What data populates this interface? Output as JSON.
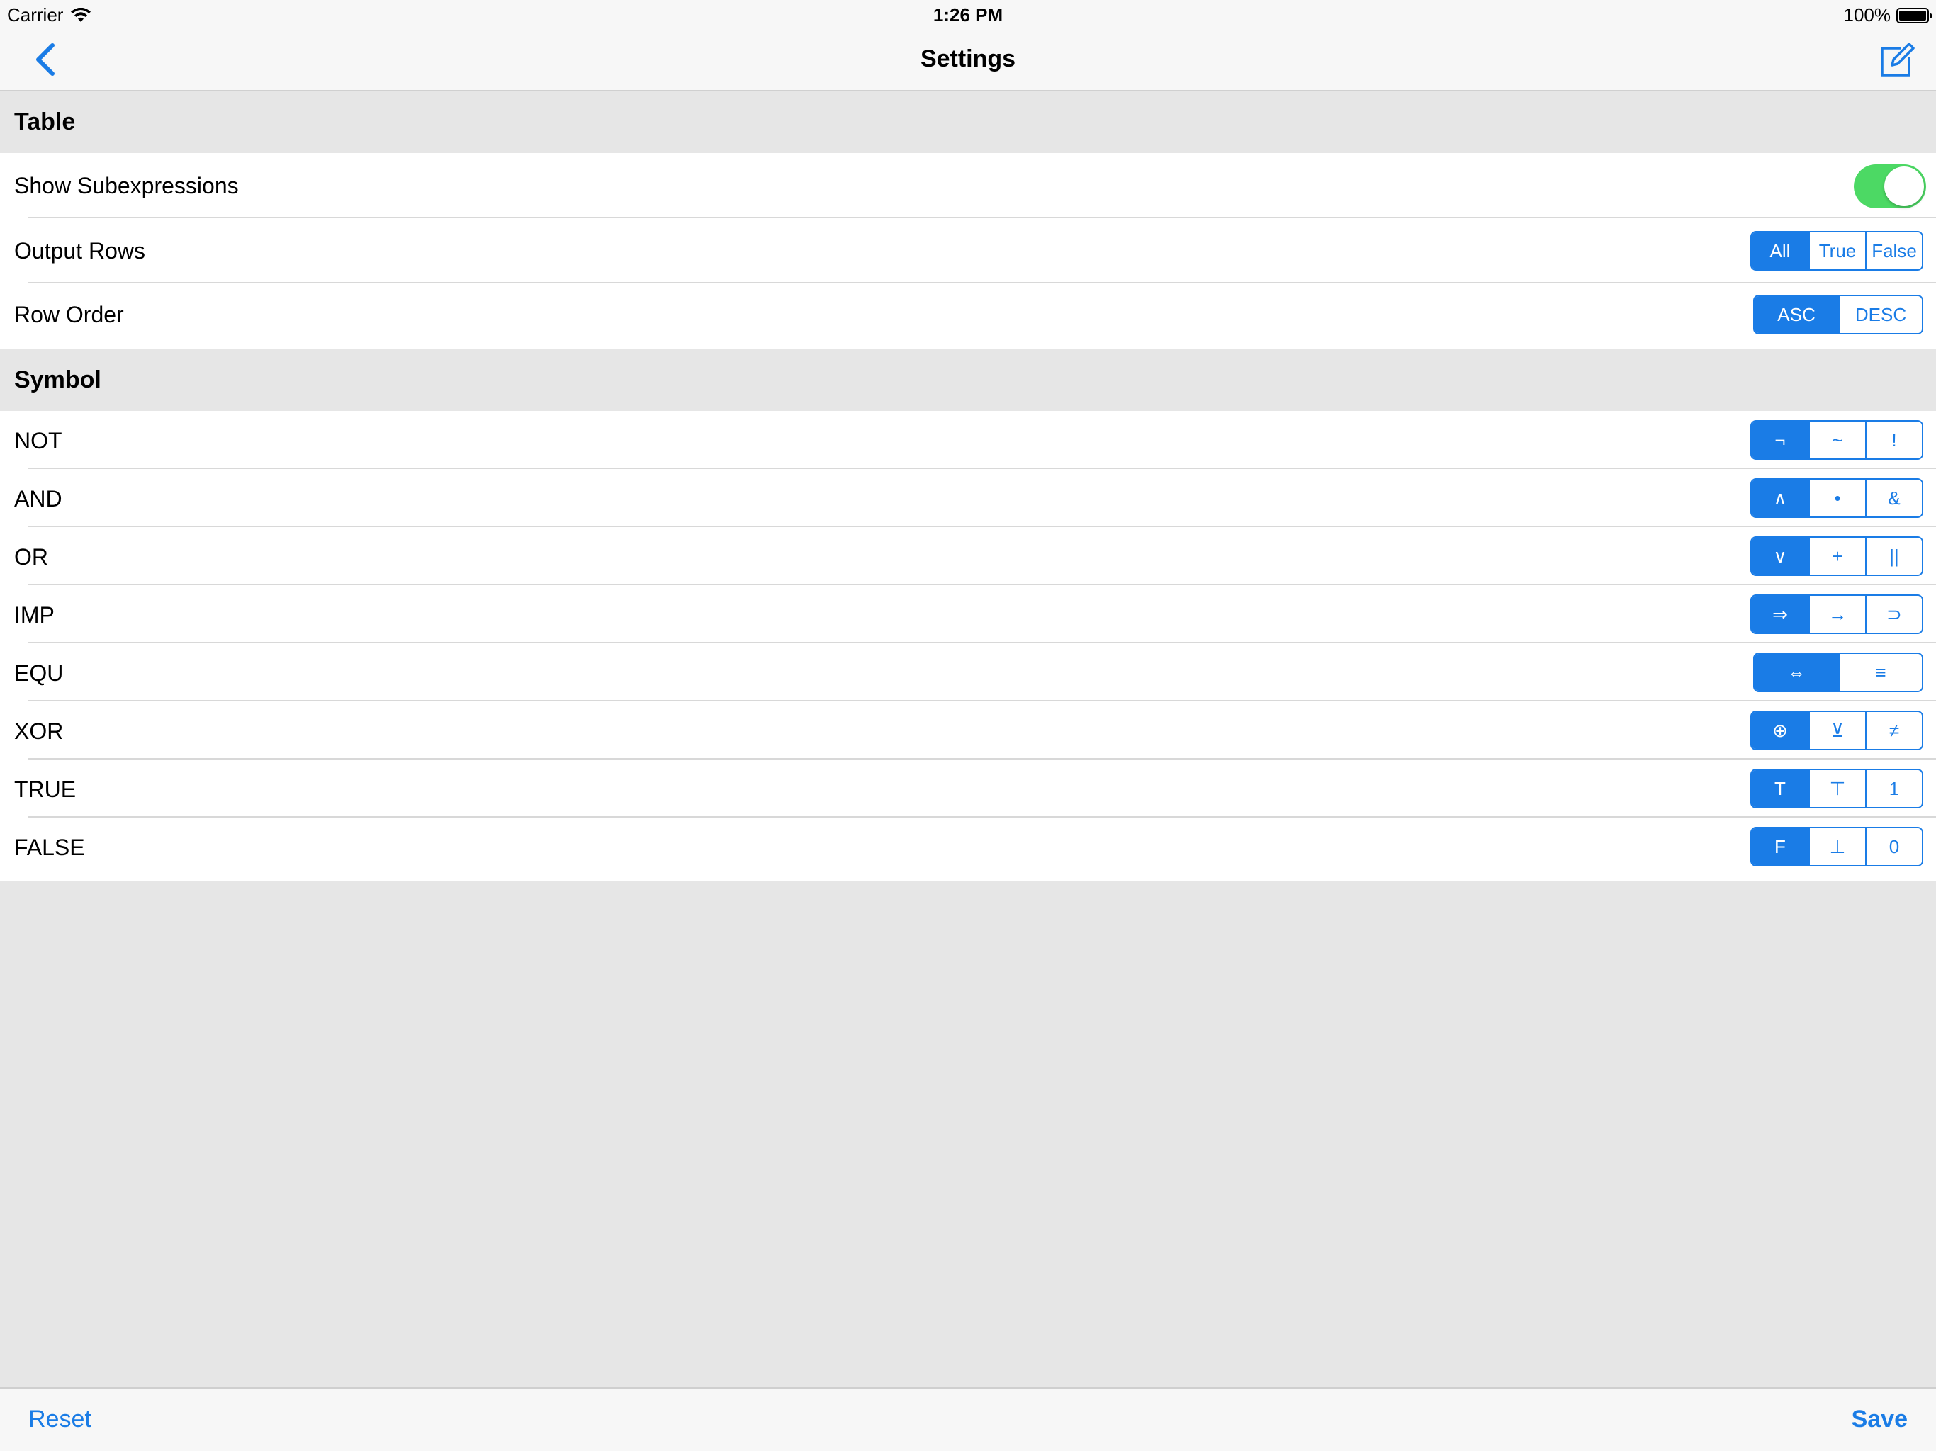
{
  "status_bar": {
    "carrier": "Carrier",
    "time": "1:26 PM",
    "battery": "100%"
  },
  "nav": {
    "title": "Settings",
    "back_icon": "chevron-left-icon",
    "compose_icon": "compose-icon"
  },
  "sections": {
    "table": {
      "header": "Table",
      "show_subexpressions": {
        "label": "Show  Subexpressions",
        "on": true
      },
      "output_rows": {
        "label": "Output Rows",
        "options": [
          "All",
          "True",
          "False"
        ],
        "selected": "All"
      },
      "row_order": {
        "label": "Row Order",
        "options": [
          "ASC",
          "DESC"
        ],
        "selected": "ASC"
      }
    },
    "symbol": {
      "header": "Symbol",
      "rows": [
        {
          "label": "NOT",
          "options": [
            "¬",
            "~",
            "!"
          ],
          "selected": "¬"
        },
        {
          "label": "AND",
          "options": [
            "∧",
            "•",
            "&"
          ],
          "selected": "∧"
        },
        {
          "label": "OR",
          "options": [
            "∨",
            "+",
            "||"
          ],
          "selected": "∨"
        },
        {
          "label": "IMP",
          "options": [
            "⇒",
            "→",
            "⊃"
          ],
          "selected": "⇒"
        },
        {
          "label": "EQU",
          "options": [
            "⇔",
            "≡"
          ],
          "selected": "⇔"
        },
        {
          "label": "XOR",
          "options": [
            "⊕",
            "⊻",
            "≠"
          ],
          "selected": "⊕"
        },
        {
          "label": "TRUE",
          "options": [
            "T",
            "⊤",
            "1"
          ],
          "selected": "T"
        },
        {
          "label": "FALSE",
          "options": [
            "F",
            "⊥",
            "0"
          ],
          "selected": "F"
        }
      ]
    }
  },
  "toolbar": {
    "reset_label": "Reset",
    "save_label": "Save"
  },
  "colors": {
    "accent": "#1a7ce6",
    "toggle_on": "#4cd964",
    "background": "#e6e6e6"
  }
}
